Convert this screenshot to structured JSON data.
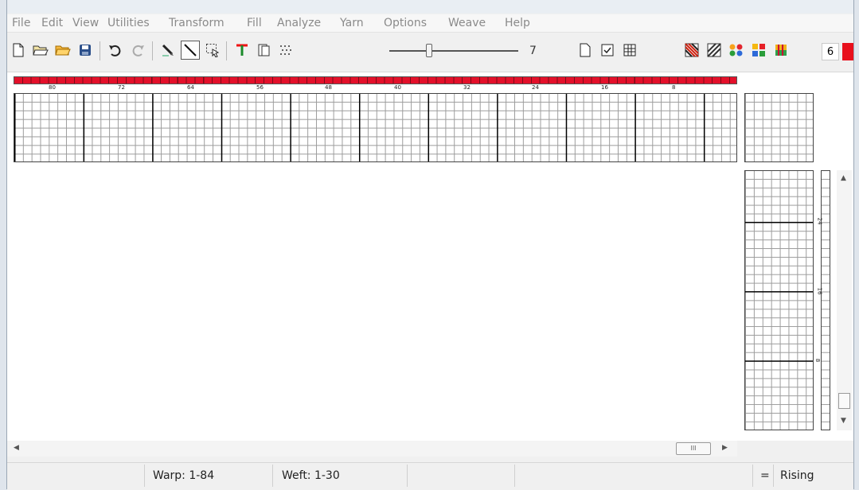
{
  "menu": [
    "File",
    "Edit",
    "View",
    "Utilities",
    "Transform",
    "Fill",
    "Analyze",
    "Yarn",
    "Options",
    "Weave",
    "Help"
  ],
  "toolbar": {
    "slider_value": "7",
    "color_count": "6",
    "active_color": "#e8101c"
  },
  "warp_ruler": [
    "80",
    "72",
    "64",
    "56",
    "48",
    "40",
    "32",
    "24",
    "16",
    "8"
  ],
  "weft_ruler": [
    "24",
    "16",
    "8"
  ],
  "status": {
    "warp": "Warp: 1-84",
    "weft": "Weft: 1-30",
    "equals": "=",
    "mode": "Rising"
  },
  "scrollbar": {
    "thumb_grip": "III"
  }
}
